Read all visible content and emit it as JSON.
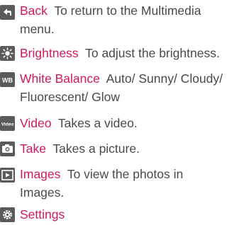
{
  "items": [
    {
      "icon": "back-arrow-icon",
      "name": "Back",
      "desc_line1": "To return to the Multimedia",
      "desc_line2": "menu."
    },
    {
      "icon": "brightness-sun-icon",
      "name": "Brightness",
      "desc_line1": "To adjust the brightness.",
      "desc_line2": ""
    },
    {
      "icon": "white-balance-icon",
      "name": "White Balance",
      "desc_line1": "Auto/ Sunny/ Cloudy/",
      "desc_line2": "Fluorescent/ Glow"
    },
    {
      "icon": "video-icon",
      "name": "Video",
      "desc_line1": "Takes a video.",
      "desc_line2": ""
    },
    {
      "icon": "camera-icon",
      "name": "Take",
      "desc_line1": "Takes a picture.",
      "desc_line2": ""
    },
    {
      "icon": "images-play-icon",
      "name": "Images",
      "desc_line1": "To view the photos in",
      "desc_line2": "Images."
    },
    {
      "icon": "settings-gear-icon",
      "name": "Settings",
      "desc_line1": "",
      "desc_line2": ""
    }
  ],
  "icon_labels": {
    "video": "Video",
    "white_balance": "WB"
  },
  "colors": {
    "term": "#d0195e",
    "body_text": "#4a4a4a",
    "icon_bg": "#5b5b5b"
  }
}
